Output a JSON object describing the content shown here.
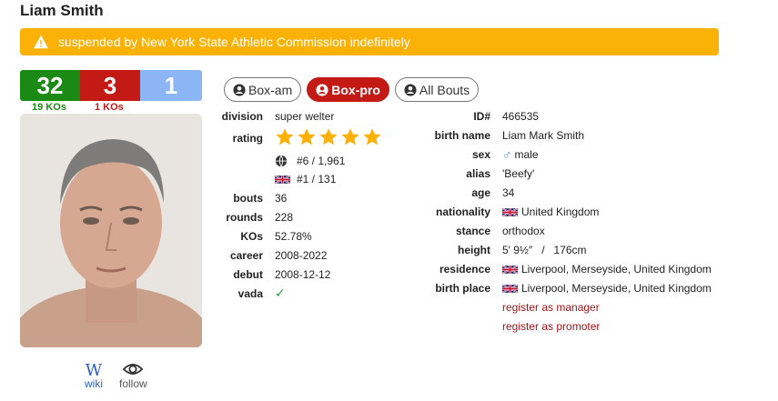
{
  "boxer": {
    "name": "Liam Smith",
    "alert": "suspended by New York State Athletic Commission indefinitely"
  },
  "record": {
    "wins": "32",
    "losses": "3",
    "draws": "1",
    "win_kos": "19 KOs",
    "loss_kos": "1 KOs"
  },
  "side_links": {
    "wiki_icon": "W",
    "wiki_label": "wiki",
    "follow_label": "follow"
  },
  "tabs": [
    {
      "label": "Box-am",
      "active": false
    },
    {
      "label": "Box-pro",
      "active": true
    },
    {
      "label": "All Bouts",
      "active": false
    }
  ],
  "left_stats": {
    "division_label": "division",
    "division": "super welter",
    "rating_label": "rating",
    "rating_stars": 5,
    "world_rank": "#6 / 1,961",
    "uk_rank": "#1 / 131",
    "bouts_label": "bouts",
    "bouts": "36",
    "rounds_label": "rounds",
    "rounds": "228",
    "kos_label": "KOs",
    "kos": "52.78%",
    "career_label": "career",
    "career": "2008-2022",
    "debut_label": "debut",
    "debut": "2008-12-12",
    "vada_label": "vada",
    "vada": "✓"
  },
  "right_stats": {
    "id_label": "ID#",
    "id": "466535",
    "birth_name_label": "birth name",
    "birth_name": "Liam Mark Smith",
    "sex_label": "sex",
    "sex": "male",
    "alias_label": "alias",
    "alias": "'Beefy'",
    "age_label": "age",
    "age": "34",
    "nationality_label": "nationality",
    "nationality": "United Kingdom",
    "stance_label": "stance",
    "stance": "orthodox",
    "height_label": "height",
    "height": "5′ 9½″   /   176cm",
    "residence_label": "residence",
    "residence": "Liverpool, Merseyside, United Kingdom",
    "birth_place_label": "birth place",
    "birth_place": "Liverpool, Merseyside, United Kingdom",
    "register_manager": "register as manager",
    "register_promoter": "register as promoter"
  },
  "colors": {
    "win": "#1a8a14",
    "loss": "#c41a16",
    "draw": "#8bb5f5",
    "alert": "#fcb106",
    "star": "#fcb106",
    "link": "#a0161a"
  }
}
